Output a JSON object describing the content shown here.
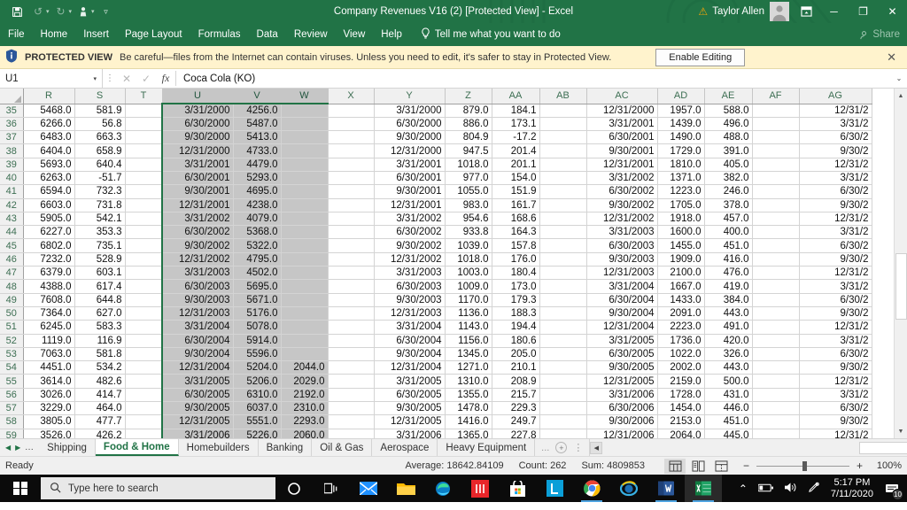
{
  "titlebar": {
    "document_title": "Company Revenues V16 (2)  [Protected View]  -  Excel",
    "save_icon": "save-icon",
    "undo_icon": "undo-icon",
    "redo_icon": "redo-icon",
    "touch_icon": "touch-mode-icon",
    "customize_icon": "customize-qat-icon",
    "warning_icon": "warning-triangle-icon",
    "user_name": "Taylor Allen",
    "ribbon_options_icon": "ribbon-display-options-icon",
    "minimize_label": "─",
    "restore_label": "❐",
    "close_label": "✕"
  },
  "ribbon": {
    "tabs": [
      "File",
      "Home",
      "Insert",
      "Page Layout",
      "Formulas",
      "Data",
      "Review",
      "View",
      "Help"
    ],
    "tellme": "Tell me what you want to do",
    "share_label": "Share"
  },
  "protected_view": {
    "label": "PROTECTED VIEW",
    "message": "Be careful—files from the Internet can contain viruses. Unless you need to edit, it's safer to stay in Protected View.",
    "button": "Enable Editing",
    "close_label": "✕"
  },
  "formula_bar": {
    "name_box": "U1",
    "cancel_label": "✕",
    "confirm_label": "✓",
    "fx_label": "fx",
    "value": "Coca Cola (KO)",
    "expand_label": "⌄"
  },
  "grid": {
    "columns": [
      "R",
      "S",
      "T",
      "U",
      "V",
      "W",
      "X",
      "Y",
      "Z",
      "AA",
      "AB",
      "AC",
      "AD",
      "AE",
      "AF",
      "AG"
    ],
    "selected_columns": [
      "U",
      "V",
      "W"
    ],
    "rows": [
      {
        "n": "35",
        "cells": [
          "5468.0",
          "581.9",
          "",
          "3/31/2000",
          "4256.0",
          "",
          "",
          "3/31/2000",
          "879.0",
          "184.1",
          "",
          "12/31/2000",
          "1957.0",
          "588.0",
          "",
          "12/31/2"
        ]
      },
      {
        "n": "36",
        "cells": [
          "6266.0",
          "56.8",
          "",
          "6/30/2000",
          "5487.0",
          "",
          "",
          "6/30/2000",
          "886.0",
          "173.1",
          "",
          "3/31/2001",
          "1439.0",
          "496.0",
          "",
          "3/31/2"
        ]
      },
      {
        "n": "37",
        "cells": [
          "6483.0",
          "663.3",
          "",
          "9/30/2000",
          "5413.0",
          "",
          "",
          "9/30/2000",
          "804.9",
          "-17.2",
          "",
          "6/30/2001",
          "1490.0",
          "488.0",
          "",
          "6/30/2"
        ]
      },
      {
        "n": "38",
        "cells": [
          "6404.0",
          "658.9",
          "",
          "12/31/2000",
          "4733.0",
          "",
          "",
          "12/31/2000",
          "947.5",
          "201.4",
          "",
          "9/30/2001",
          "1729.0",
          "391.0",
          "",
          "9/30/2"
        ]
      },
      {
        "n": "39",
        "cells": [
          "5693.0",
          "640.4",
          "",
          "3/31/2001",
          "4479.0",
          "",
          "",
          "3/31/2001",
          "1018.0",
          "201.1",
          "",
          "12/31/2001",
          "1810.0",
          "405.0",
          "",
          "12/31/2"
        ]
      },
      {
        "n": "40",
        "cells": [
          "6263.0",
          "-51.7",
          "",
          "6/30/2001",
          "5293.0",
          "",
          "",
          "6/30/2001",
          "977.0",
          "154.0",
          "",
          "3/31/2002",
          "1371.0",
          "382.0",
          "",
          "3/31/2"
        ]
      },
      {
        "n": "41",
        "cells": [
          "6594.0",
          "732.3",
          "",
          "9/30/2001",
          "4695.0",
          "",
          "",
          "9/30/2001",
          "1055.0",
          "151.9",
          "",
          "6/30/2002",
          "1223.0",
          "246.0",
          "",
          "6/30/2"
        ]
      },
      {
        "n": "42",
        "cells": [
          "6603.0",
          "731.8",
          "",
          "12/31/2001",
          "4238.0",
          "",
          "",
          "12/31/2001",
          "983.0",
          "161.7",
          "",
          "9/30/2002",
          "1705.0",
          "378.0",
          "",
          "9/30/2"
        ]
      },
      {
        "n": "43",
        "cells": [
          "5905.0",
          "542.1",
          "",
          "3/31/2002",
          "4079.0",
          "",
          "",
          "3/31/2002",
          "954.6",
          "168.6",
          "",
          "12/31/2002",
          "1918.0",
          "457.0",
          "",
          "12/31/2"
        ]
      },
      {
        "n": "44",
        "cells": [
          "6227.0",
          "353.3",
          "",
          "6/30/2002",
          "5368.0",
          "",
          "",
          "6/30/2002",
          "933.8",
          "164.3",
          "",
          "3/31/2003",
          "1600.0",
          "400.0",
          "",
          "3/31/2"
        ]
      },
      {
        "n": "45",
        "cells": [
          "6802.0",
          "735.1",
          "",
          "9/30/2002",
          "5322.0",
          "",
          "",
          "9/30/2002",
          "1039.0",
          "157.8",
          "",
          "6/30/2003",
          "1455.0",
          "451.0",
          "",
          "6/30/2"
        ]
      },
      {
        "n": "46",
        "cells": [
          "7232.0",
          "528.9",
          "",
          "12/31/2002",
          "4795.0",
          "",
          "",
          "12/31/2002",
          "1018.0",
          "176.0",
          "",
          "9/30/2003",
          "1909.0",
          "416.0",
          "",
          "9/30/2"
        ]
      },
      {
        "n": "47",
        "cells": [
          "6379.0",
          "603.1",
          "",
          "3/31/2003",
          "4502.0",
          "",
          "",
          "3/31/2003",
          "1003.0",
          "180.4",
          "",
          "12/31/2003",
          "2100.0",
          "476.0",
          "",
          "12/31/2"
        ]
      },
      {
        "n": "48",
        "cells": [
          "4388.0",
          "617.4",
          "",
          "6/30/2003",
          "5695.0",
          "",
          "",
          "6/30/2003",
          "1009.0",
          "173.0",
          "",
          "3/31/2004",
          "1667.0",
          "419.0",
          "",
          "3/31/2"
        ]
      },
      {
        "n": "49",
        "cells": [
          "7608.0",
          "644.8",
          "",
          "9/30/2003",
          "5671.0",
          "",
          "",
          "9/30/2003",
          "1170.0",
          "179.3",
          "",
          "6/30/2004",
          "1433.0",
          "384.0",
          "",
          "6/30/2"
        ]
      },
      {
        "n": "50",
        "cells": [
          "7364.0",
          "627.0",
          "",
          "12/31/2003",
          "5176.0",
          "",
          "",
          "12/31/2003",
          "1136.0",
          "188.3",
          "",
          "9/30/2004",
          "2091.0",
          "443.0",
          "",
          "9/30/2"
        ]
      },
      {
        "n": "51",
        "cells": [
          "6245.0",
          "583.3",
          "",
          "3/31/2004",
          "5078.0",
          "",
          "",
          "3/31/2004",
          "1143.0",
          "194.4",
          "",
          "12/31/2004",
          "2223.0",
          "491.0",
          "",
          "12/31/2"
        ]
      },
      {
        "n": "52",
        "cells": [
          "1119.0",
          "116.9",
          "",
          "6/30/2004",
          "5914.0",
          "",
          "",
          "6/30/2004",
          "1156.0",
          "180.6",
          "",
          "3/31/2005",
          "1736.0",
          "420.0",
          "",
          "3/31/2"
        ]
      },
      {
        "n": "53",
        "cells": [
          "7063.0",
          "581.8",
          "",
          "9/30/2004",
          "5596.0",
          "",
          "",
          "9/30/2004",
          "1345.0",
          "205.0",
          "",
          "6/30/2005",
          "1022.0",
          "326.0",
          "",
          "6/30/2"
        ]
      },
      {
        "n": "54",
        "cells": [
          "4451.0",
          "534.2",
          "",
          "12/31/2004",
          "5204.0",
          "2044.0",
          "",
          "12/31/2004",
          "1271.0",
          "210.1",
          "",
          "9/30/2005",
          "2002.0",
          "443.0",
          "",
          "9/30/2"
        ]
      },
      {
        "n": "55",
        "cells": [
          "3614.0",
          "482.6",
          "",
          "3/31/2005",
          "5206.0",
          "2029.0",
          "",
          "3/31/2005",
          "1310.0",
          "208.9",
          "",
          "12/31/2005",
          "2159.0",
          "500.0",
          "",
          "12/31/2"
        ]
      },
      {
        "n": "56",
        "cells": [
          "3026.0",
          "414.7",
          "",
          "6/30/2005",
          "6310.0",
          "2192.0",
          "",
          "6/30/2005",
          "1355.0",
          "215.7",
          "",
          "3/31/2006",
          "1728.0",
          "431.0",
          "",
          "3/31/2"
        ]
      },
      {
        "n": "57",
        "cells": [
          "3229.0",
          "464.0",
          "",
          "9/30/2005",
          "6037.0",
          "2310.0",
          "",
          "9/30/2005",
          "1478.0",
          "229.3",
          "",
          "6/30/2006",
          "1454.0",
          "446.0",
          "",
          "6/30/2"
        ]
      },
      {
        "n": "58",
        "cells": [
          "3805.0",
          "477.7",
          "",
          "12/31/2005",
          "5551.0",
          "2293.0",
          "",
          "12/31/2005",
          "1416.0",
          "249.7",
          "",
          "9/30/2006",
          "2153.0",
          "451.0",
          "",
          "9/30/2"
        ]
      },
      {
        "n": "59",
        "cells": [
          "3526.0",
          "426.2",
          "",
          "3/31/2006",
          "5226.0",
          "2060.0",
          "",
          "3/31/2006",
          "1365.0",
          "227.8",
          "",
          "12/31/2006",
          "2064.0",
          "445.0",
          "",
          "12/31/2"
        ]
      }
    ]
  },
  "sheet_tabs": {
    "first_label": "◀",
    "next_label": "▶",
    "left_ellipsis": "...",
    "tabs": [
      "Shipping",
      "Food & Home",
      "Homebuilders",
      "Banking",
      "Oil & Gas",
      "Aerospace",
      "Heavy Equipment"
    ],
    "active_tab": "Food & Home",
    "right_ellipsis": "...",
    "add_sheet_label": "+",
    "menu_label": "⋮"
  },
  "status_bar": {
    "status": "Ready",
    "average": "Average: 18642.84109",
    "count": "Count: 262",
    "sum": "Sum: 4809853",
    "view_normal": "normal-view-icon",
    "view_page_layout": "page-layout-view-icon",
    "view_page_break": "page-break-view-icon",
    "zoom_out": "−",
    "zoom_in": "+",
    "zoom_level": "100%"
  },
  "taskbar": {
    "start_label": "start-icon",
    "search_placeholder": "Type here to search",
    "search_icon": "search-icon",
    "cortana_icon": "cortana-icon",
    "taskview_icon": "task-view-icon",
    "apps": [
      "mail-icon",
      "file-explorer-icon",
      "edge-icon",
      "app-red-icon",
      "microsoft-store-icon",
      "app-blue-l-icon",
      "chrome-icon",
      "internet-explorer-icon",
      "word-icon",
      "excel-icon"
    ],
    "tray": {
      "chevron_up": "show-hidden-icons-icon",
      "battery": "battery-icon",
      "volume": "volume-icon",
      "pen": "pen-icon",
      "time": "5:17 PM",
      "date": "7/11/2020",
      "notification_count": "10"
    }
  },
  "colors": {
    "excel_green": "#217346",
    "protected_yellow": "#fff3cd",
    "selection_gray": "#c6c6c6"
  }
}
